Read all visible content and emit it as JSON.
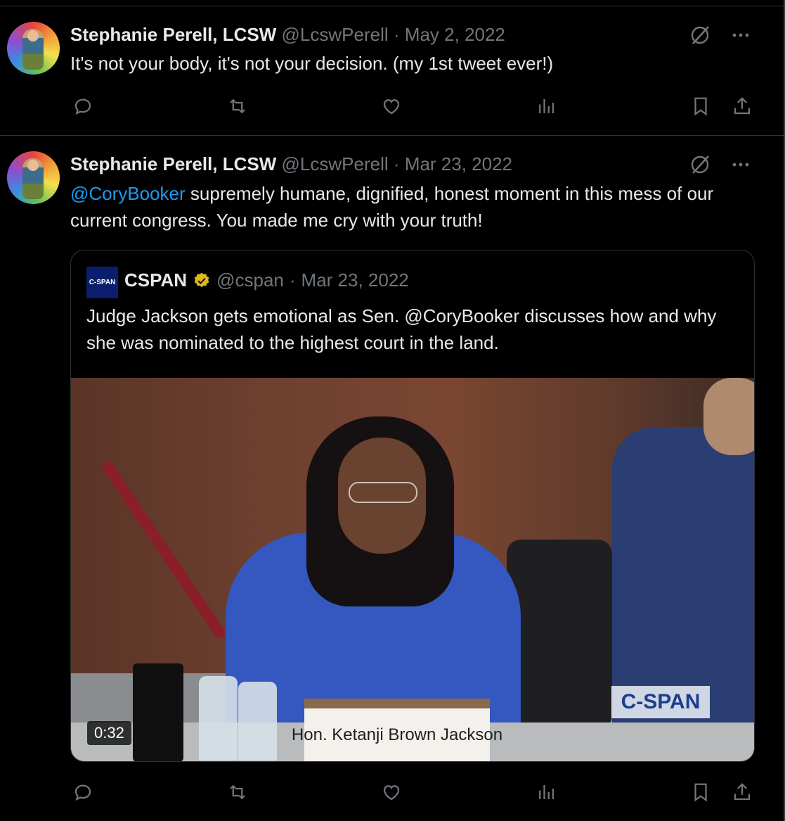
{
  "tweets": [
    {
      "author_name": "Stephanie Perell, LCSW",
      "handle": "@LcswPerell",
      "separator": "·",
      "date": "May 2, 2022",
      "text": "It's not your body, it's not your decision.  (my 1st tweet ever!)"
    },
    {
      "author_name": "Stephanie Perell, LCSW",
      "handle": "@LcswPerell",
      "separator": "·",
      "date": "Mar 23, 2022",
      "mention": "@CoryBooker",
      "text": " supremely humane, dignified, honest moment in this mess of our current congress.  You made me cry with your truth!",
      "quote": {
        "logo_text": "C-SPAN",
        "author_name": "CSPAN",
        "handle": "@cspan",
        "separator": "·",
        "date": "Mar 23, 2022",
        "text": "Judge Jackson gets emotional as Sen. @CoryBooker discusses how and why she was nominated to the highest court in the land.",
        "video": {
          "duration": "0:32",
          "nameplate": "Hon. Ketanji Brown Jackson",
          "watermark": "C-SPAN"
        }
      }
    }
  ],
  "icons": {
    "reply": "reply-icon",
    "retweet": "retweet-icon",
    "like": "like-icon",
    "views": "views-icon",
    "bookmark": "bookmark-icon",
    "share": "share-icon",
    "grok": "grok-icon",
    "more": "more-icon",
    "verified": "verified-badge-icon"
  },
  "colors": {
    "background": "#000000",
    "text": "#e7e9ea",
    "muted": "#71767b",
    "link": "#1d9bf0",
    "verified_gold": "#e2b719"
  }
}
